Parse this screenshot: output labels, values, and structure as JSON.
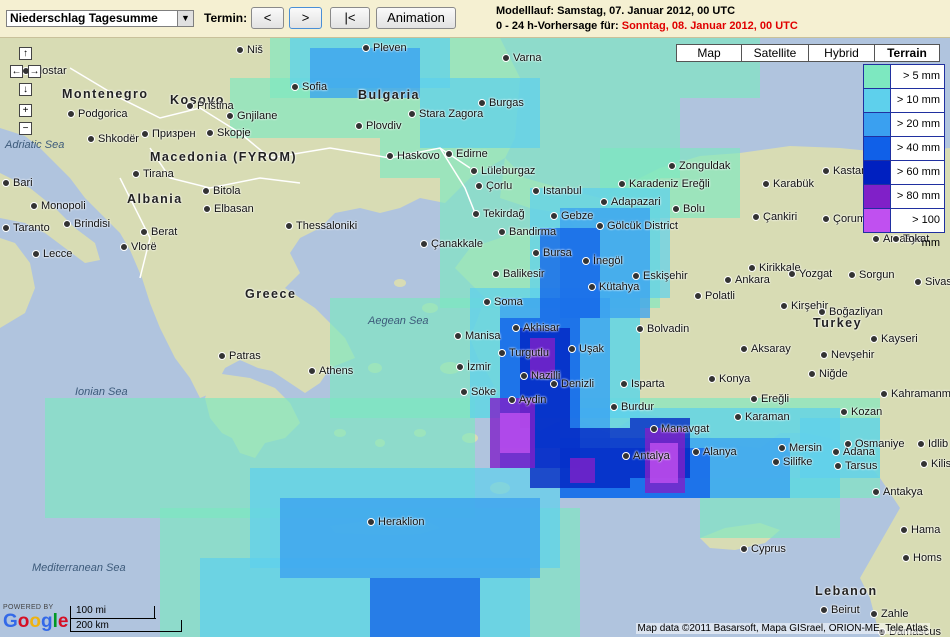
{
  "toolbar": {
    "parameter_select": "Niederschlag Tagesumme",
    "termin_label": "Termin:",
    "prev_label": "<",
    "next_label": ">",
    "first_label": "|<",
    "animation_label": "Animation",
    "run_label": "Modelllauf: Samstag, 07. Januar 2012, 00 UTC",
    "forecast_prefix": "0 - 24 h-Vorhersage für:",
    "forecast_date": "Sonntag, 08. Januar 2012, 00 UTC"
  },
  "map_types": [
    {
      "label": "Map",
      "active": false
    },
    {
      "label": "Satellite",
      "active": false
    },
    {
      "label": "Hybrid",
      "active": false
    },
    {
      "label": "Terrain",
      "active": true
    }
  ],
  "legend": [
    {
      "label": "> 5 mm",
      "color": "#7de8c0"
    },
    {
      "label": "> 10 mm",
      "color": "#5ed0ec"
    },
    {
      "label": "> 20 mm",
      "color": "#3aa0f0"
    },
    {
      "label": "> 40 mm",
      "color": "#1060e8"
    },
    {
      "label": "> 60 mm",
      "color": "#0020c0"
    },
    {
      "label": "> 80 mm",
      "color": "#8020c8"
    },
    {
      "label": "> 100 mm",
      "color": "#c050f0"
    }
  ],
  "nav_controls": {
    "up": "↑",
    "left": "←",
    "right": "→",
    "down": "↓",
    "zoom_in": "+",
    "zoom_out": "−"
  },
  "countries": [
    "Montenegro",
    "Kosovo",
    "Bulgaria",
    "Macedonia (FYROM)",
    "Albania",
    "Greece",
    "Turkey",
    "Lebanon"
  ],
  "seas": [
    "Adriatic Sea",
    "Aegean Sea",
    "Ionian Sea",
    "Mediterranean Sea"
  ],
  "cities": [
    "Niš",
    "Pleven",
    "Varna",
    "Mostar",
    "Sofia",
    "Burgas",
    "Podgorica",
    "Priština",
    "Gnjilane",
    "Stara Zagora",
    "Shkodër",
    "Призрен",
    "Skopje",
    "Plovdiv",
    "Haskovo",
    "Edirne",
    "Lüleburgaz",
    "Çorlu",
    "Istanbul",
    "Zonguldak",
    "Karabük",
    "Kastamonu",
    "Bari",
    "Tirana",
    "Bitola",
    "Karadeniz Ereğli",
    "Monopoli",
    "Elbasan",
    "Tekirdağ",
    "Gebze",
    "Adapazari",
    "Bolu",
    "Çankiri",
    "Çorum",
    "Taranto",
    "Brindisi",
    "Berat",
    "Thessaloniki",
    "Bandirma",
    "Gölcük District",
    "Amasya",
    "Lecce",
    "Vlorë",
    "Çanakkale",
    "Bursa",
    "İnegöl",
    "Kirikkale",
    "Tokat",
    "Balikesir",
    "Eskişehir",
    "Ankara",
    "Yozgat",
    "Sorgun",
    "Kütahya",
    "Polatli",
    "Sivas",
    "Soma",
    "Kirşehir",
    "Boğazliyan",
    "Akhisar",
    "Bolvadin",
    "Manisa",
    "Turgutlu",
    "Uşak",
    "Aksaray",
    "Nevşehir",
    "Kayseri",
    "Patras",
    "İzmir",
    "Nazilli",
    "Denizli",
    "Isparta",
    "Konya",
    "Niğde",
    "Athens",
    "Söke",
    "Aydin",
    "Burdur",
    "Ereğli",
    "Kahramanma",
    "Karaman",
    "Kozan",
    "Manavgat",
    "Antalya",
    "Alanya",
    "Mersin",
    "Adana",
    "Osmaniye",
    "Silifke",
    "Tarsus",
    "Kilis",
    "Antakya",
    "Idlib",
    "Heraklion",
    "Cyprus",
    "Hama",
    "Homs",
    "Beirut",
    "Zahle",
    "Damascus"
  ],
  "scale": {
    "mi": "100 mi",
    "km": "200 km"
  },
  "logo": {
    "powered": "POWERED BY",
    "word": "Google"
  },
  "attribution": "Map data ©2011 Basarsoft, Mapa GISrael, ORION-ME, Tele Atlas"
}
